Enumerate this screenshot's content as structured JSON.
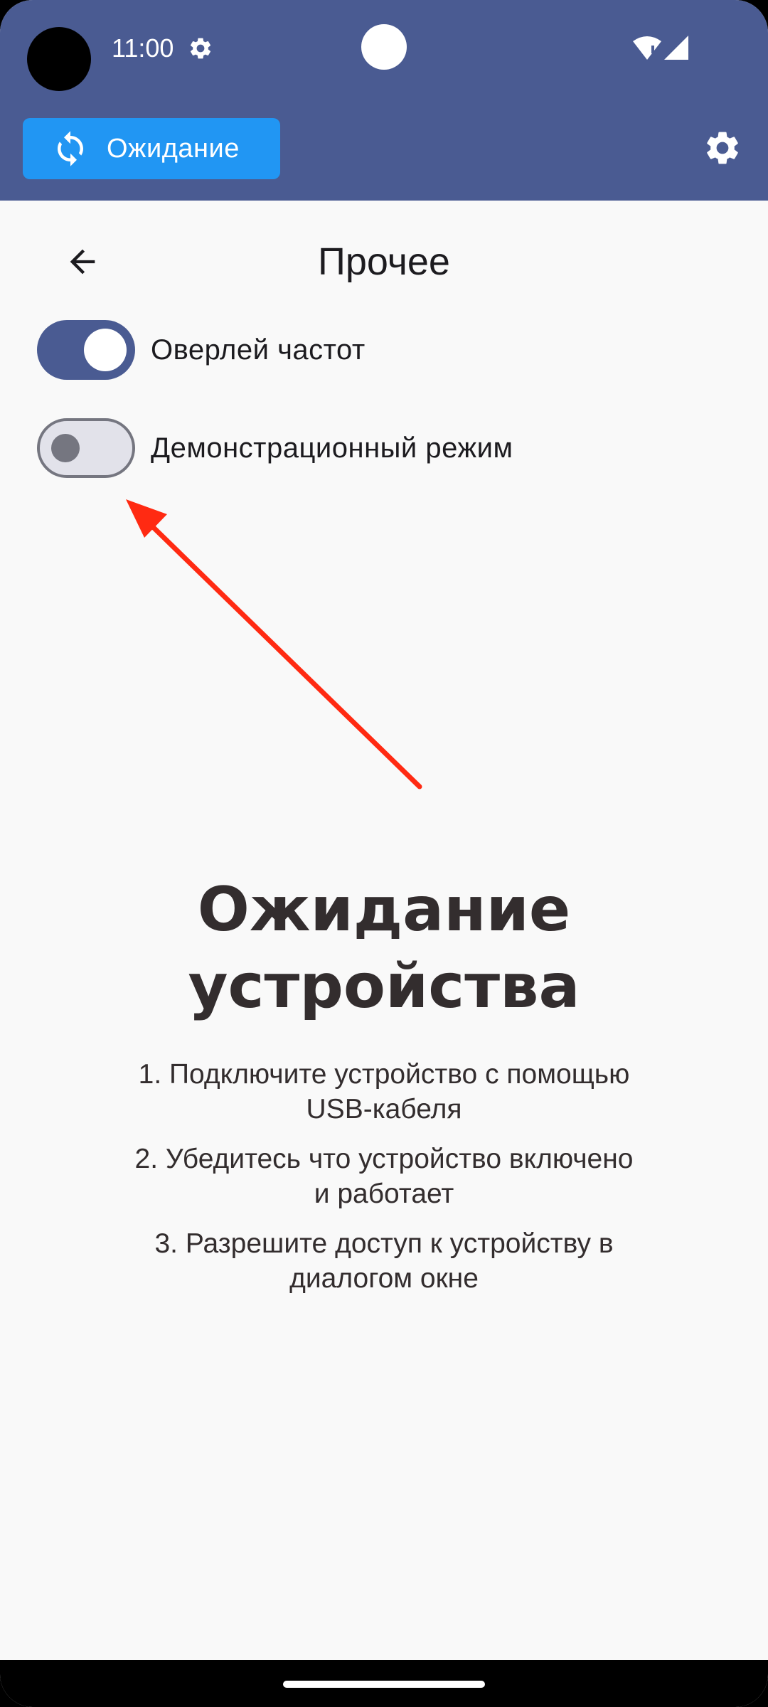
{
  "status_bar": {
    "time": "11:00"
  },
  "header": {
    "status_chip_label": "Ожидание"
  },
  "page": {
    "title": "Прочее"
  },
  "toggles": [
    {
      "label": "Оверлей частот",
      "on": true
    },
    {
      "label": "Демонстрационный режим",
      "on": false
    }
  ],
  "waiting": {
    "title": "Ожидание устройства",
    "steps": [
      "1. Подключите устройство с помощью USB-кабеля",
      "2. Убедитесь что устройство включено и работает",
      "3. Разрешите доступ к устройству в диалогом окне"
    ]
  },
  "colors": {
    "header_bg": "#4a5b92",
    "chip_bg": "#2196f3",
    "annotation_arrow": "#ff2a12"
  },
  "icons": {
    "status_settings": "gear-icon",
    "wifi": "wifi-icon",
    "signal": "signal-icon",
    "chip": "sync-icon",
    "settings": "settings-icon",
    "back": "back-arrow-icon"
  }
}
